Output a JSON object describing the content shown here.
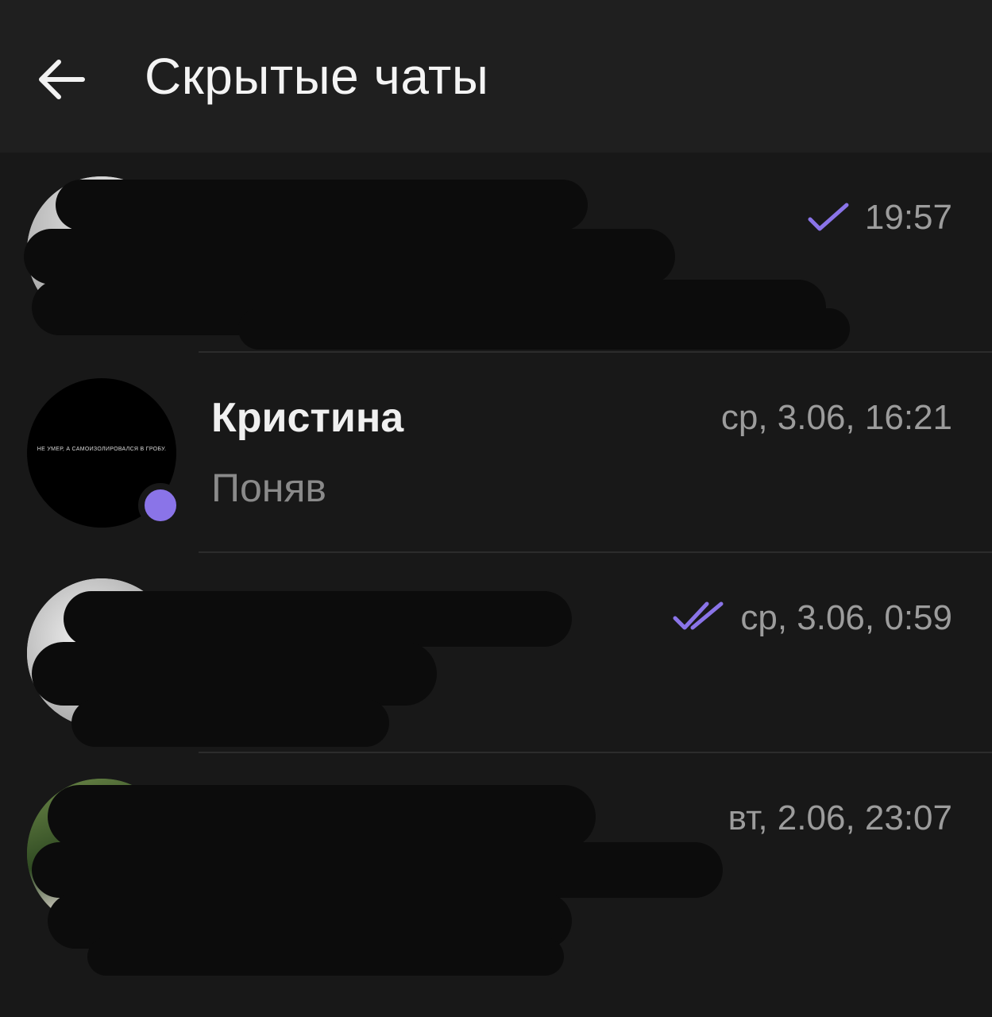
{
  "app_bar": {
    "title": "Скрытые чаты",
    "back_icon": "arrow-left-icon"
  },
  "colors": {
    "background": "#181818",
    "app_bar": "#1f1f1f",
    "accent": "#8a74e8",
    "secondary_text": "#9c9c9c"
  },
  "chats": [
    {
      "name": "",
      "preview": "",
      "time": "19:57",
      "status_icon": "single-check-icon",
      "redacted": true
    },
    {
      "name": "Кристина",
      "preview": "Поняв",
      "time": "ср, 3.06, 16:21",
      "online": true,
      "avatar_caption": "НЕ УМЕР, А САМОИЗОЛИРОВАЛСЯ В ГРОБУ."
    },
    {
      "name": "",
      "preview": "",
      "time": "ср, 3.06, 0:59",
      "status_icon": "double-check-icon",
      "redacted": true
    },
    {
      "name": "",
      "preview": "",
      "time": "вт, 2.06, 23:07",
      "redacted": true
    }
  ]
}
